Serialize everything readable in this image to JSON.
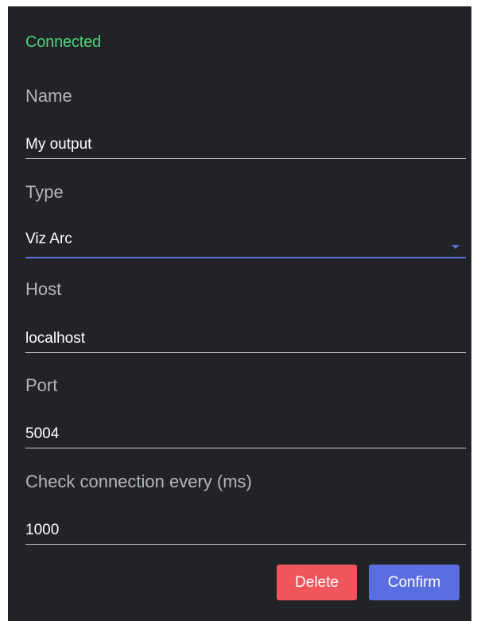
{
  "status": {
    "text": "Connected",
    "color": "#4fd17a"
  },
  "fields": {
    "name": {
      "label": "Name",
      "value": "My output"
    },
    "type": {
      "label": "Type",
      "value": "Viz Arc",
      "icon": "chevron-down-icon"
    },
    "host": {
      "label": "Host",
      "value": "localhost"
    },
    "port": {
      "label": "Port",
      "value": "5004"
    },
    "interval": {
      "label": "Check connection every (ms)",
      "value": "1000"
    }
  },
  "buttons": {
    "delete": {
      "label": "Delete",
      "color": "#f0555b"
    },
    "confirm": {
      "label": "Confirm",
      "color": "#5b6ee1"
    }
  },
  "colors": {
    "panel_background": "#222326",
    "accent": "#5b6ee1"
  }
}
